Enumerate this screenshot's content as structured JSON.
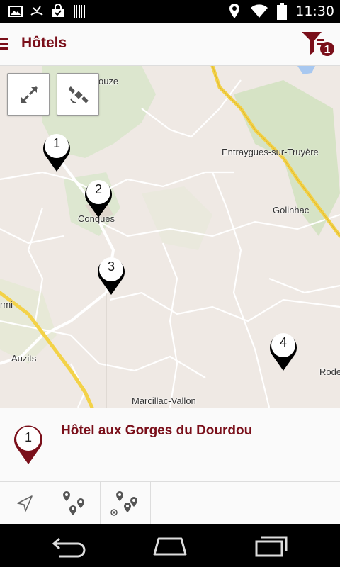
{
  "statusbar": {
    "time": "11:30",
    "left_icons": [
      "image-icon",
      "missed-call-icon",
      "shopping-bag-icon",
      "barcode-icon"
    ],
    "right_icons": [
      "location-icon",
      "wifi-icon",
      "battery-icon"
    ]
  },
  "appbar": {
    "title": "Hôtels",
    "filter_badge": "1",
    "accent_color": "#7a0f1a"
  },
  "map": {
    "buttons": [
      "fullscreen-icon",
      "satellite-icon"
    ],
    "places": [
      "Cassaniouze",
      "Entraygues-sur-Truyère",
      "Golinhac",
      "Conques",
      "rmi",
      "Auzits",
      "Marcillac-Vallon",
      "Rode"
    ],
    "markers": [
      "1",
      "2",
      "3",
      "4"
    ]
  },
  "selected_hotel": {
    "number": "1",
    "name": "Hôtel aux Gorges du Dourdou"
  },
  "toolbar": {
    "tools": [
      "navigate-icon",
      "nearby-icon",
      "around-me-icon"
    ]
  },
  "navbar": {
    "buttons": [
      "back-icon",
      "home-icon",
      "recent-apps-icon"
    ]
  }
}
